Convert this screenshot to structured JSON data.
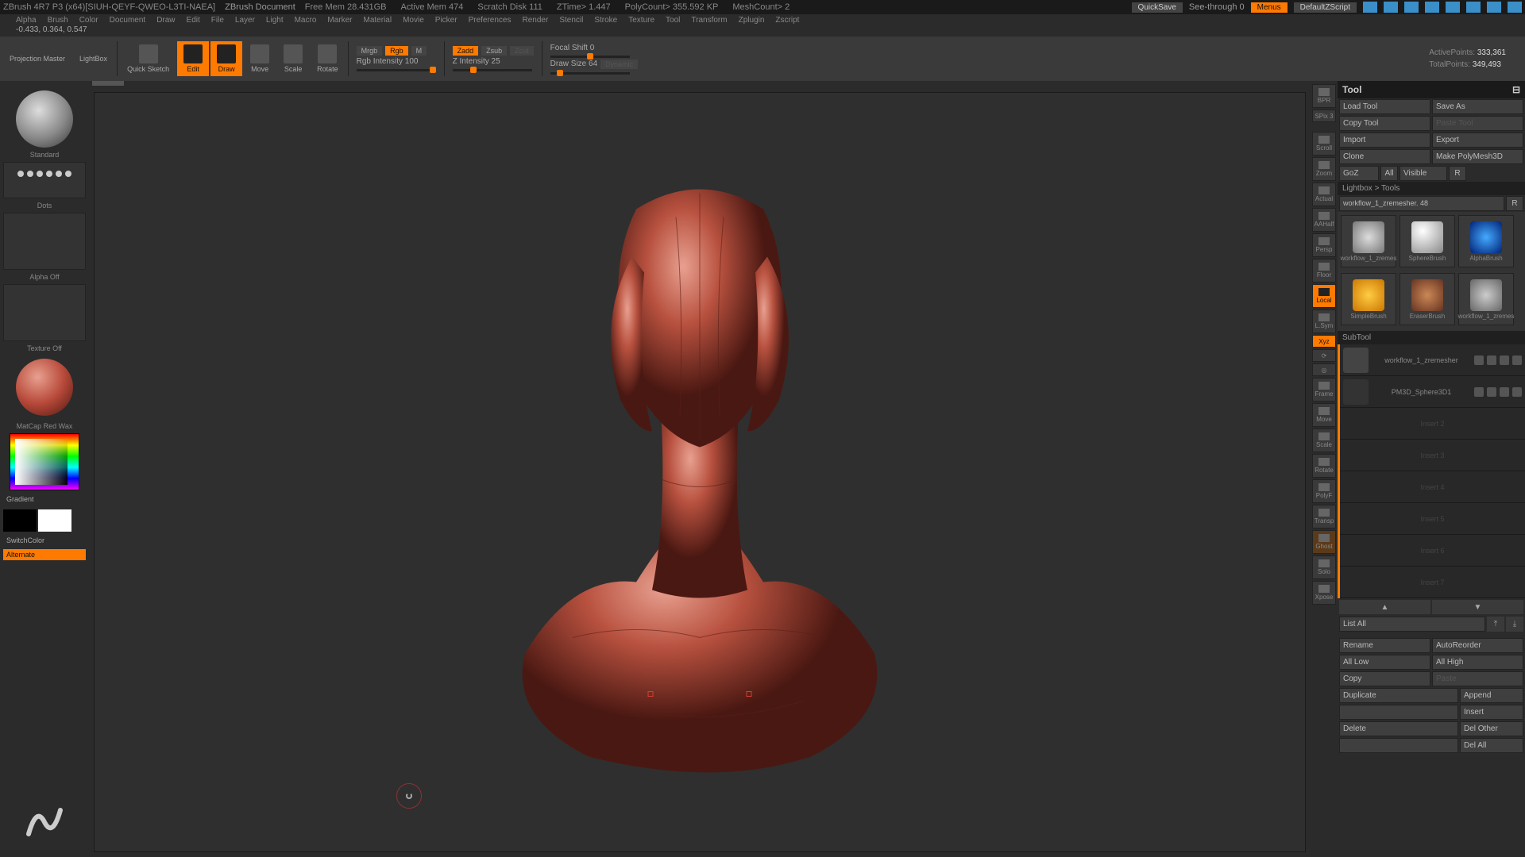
{
  "titlebar": {
    "app": "ZBrush 4R7 P3 (x64)[SIUH-QEYF-QWEO-L3TI-NAEA]",
    "doc": "ZBrush Document",
    "freemem": "Free Mem 28.431GB",
    "activemem": "Active Mem 474",
    "scratch": "Scratch Disk 111",
    "ztime": "ZTime> 1.447",
    "polycount": "PolyCount> 355.592 KP",
    "meshcount": "MeshCount> 2",
    "quicksave": "QuickSave",
    "seethrough": "See-through  0",
    "menus": "Menus",
    "defaultscript": "DefaultZScript"
  },
  "menubar": [
    "Alpha",
    "Brush",
    "Color",
    "Document",
    "Draw",
    "Edit",
    "File",
    "Layer",
    "Light",
    "Macro",
    "Marker",
    "Material",
    "Movie",
    "Picker",
    "Preferences",
    "Render",
    "Stencil",
    "Stroke",
    "Texture",
    "Tool",
    "Transform",
    "Zplugin",
    "Zscript"
  ],
  "coords": "-0.433, 0.364, 0.547",
  "shelf": {
    "projection": "Projection Master",
    "lightbox": "LightBox",
    "quicksketch": "Quick Sketch",
    "edit": "Edit",
    "draw": "Draw",
    "move": "Move",
    "scale": "Scale",
    "rotate": "Rotate",
    "mrgb": "Mrgb",
    "rgb": "Rgb",
    "m": "M",
    "rgbintensity": "Rgb Intensity 100",
    "zadd": "Zadd",
    "zsub": "Zsub",
    "zcut": "Zcut",
    "zintensity": "Z Intensity 25",
    "focalshift": "Focal Shift 0",
    "drawsize": "Draw Size 64",
    "dynamic": "Dynamic",
    "activepoints_l": "ActivePoints:",
    "activepoints_v": "333,361",
    "totalpoints_l": "TotalPoints:",
    "totalpoints_v": "349,493"
  },
  "left": {
    "brush": "Standard",
    "dots": "Dots",
    "alpha": "Alpha Off",
    "texture": "Texture Off",
    "material": "MatCap Red Wax",
    "gradient": "Gradient",
    "switchcolor": "SwitchColor",
    "alternate": "Alternate"
  },
  "rightstrip": [
    "BPR",
    "SPix 3",
    "Scroll",
    "Zoom",
    "Actual",
    "AAHalf",
    "Persp",
    "Floor",
    "Local",
    "L.Sym",
    "Xyz",
    "",
    "",
    "Frame",
    "Move",
    "Scale",
    "Rotate",
    "PolyF",
    "Transp",
    "Ghost",
    "Solo",
    "Xpose"
  ],
  "tool": {
    "title": "Tool",
    "loadtool": "Load Tool",
    "saveas": "Save As",
    "copytool": "Copy Tool",
    "pastetool": "Paste Tool",
    "import": "Import",
    "export": "Export",
    "clone": "Clone",
    "makepoly": "Make PolyMesh3D",
    "goz": "GoZ",
    "all": "All",
    "visible": "Visible",
    "r": "R",
    "lightbox": "Lightbox > Tools",
    "toolname": "workflow_1_zremesher. 48",
    "thumbs": [
      "workflow_1_zremes",
      "SphereBrush",
      "AlphaBrush",
      "SimpleBrush",
      "EraserBrush",
      "workflow_1_zremes"
    ],
    "subtool": "SubTool",
    "subtools": [
      {
        "name": "workflow_1_zremesher",
        "dim": false
      },
      {
        "name": "PM3D_Sphere3D1",
        "dim": false
      },
      {
        "name": "Insert 2",
        "dim": true
      },
      {
        "name": "Insert 3",
        "dim": true
      },
      {
        "name": "Insert 4",
        "dim": true
      },
      {
        "name": "Insert 5",
        "dim": true
      },
      {
        "name": "Insert 6",
        "dim": true
      },
      {
        "name": "Insert 7",
        "dim": true
      }
    ],
    "listall": "List All",
    "rename": "Rename",
    "autoreorder": "AutoReorder",
    "alllow": "All Low",
    "allhigh": "All High",
    "copy": "Copy",
    "paste": "Paste",
    "duplicate": "Duplicate",
    "append": "Append",
    "insert": "Insert",
    "delete": "Delete",
    "delother": "Del Other",
    "delall": "Del All"
  }
}
